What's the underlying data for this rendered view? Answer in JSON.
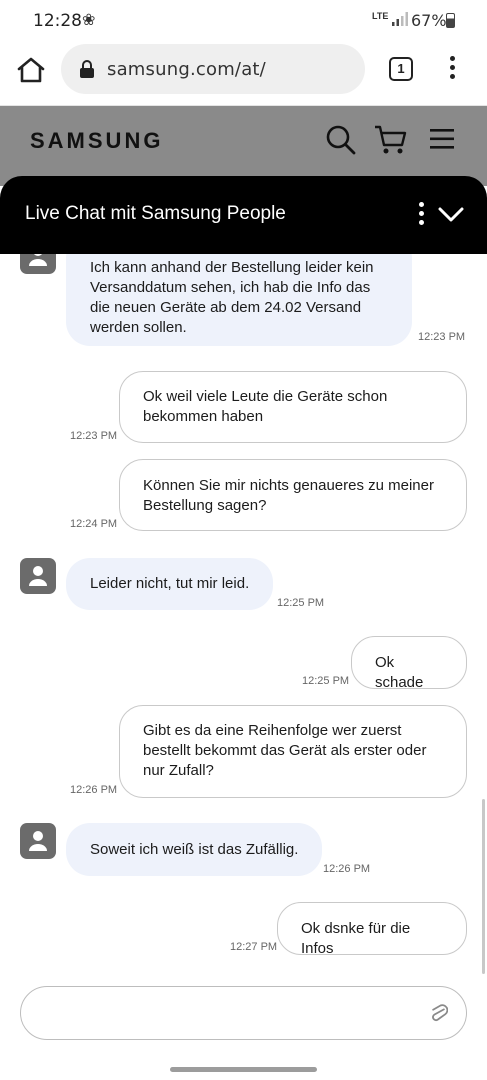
{
  "status": {
    "time": "12:28",
    "fan_glyph": "❀",
    "network": "LTE",
    "battery": "67%",
    "battery_level": 0.67
  },
  "browser": {
    "url": "samsung.com/at/",
    "tab_count": "1"
  },
  "site": {
    "brand": "SAMSUNG"
  },
  "chat": {
    "title": "Live Chat mit Samsung People",
    "messages": [
      {
        "from": "agent",
        "text": "Ich kann anhand der Bestellung leider kein Versanddatum sehen, ich hab die Info das die neuen Geräte ab dem 24.02 Versand werden sollen.",
        "time": "12:23 PM"
      },
      {
        "from": "user",
        "text": "Ok weil viele Leute die Geräte schon bekommen haben",
        "time": "12:23 PM"
      },
      {
        "from": "user",
        "text": "Können Sie mir nichts genaueres zu meiner Bestellung sagen?",
        "time": "12:24 PM"
      },
      {
        "from": "agent",
        "text": "Leider nicht, tut mir leid.",
        "time": "12:25 PM"
      },
      {
        "from": "user",
        "text": "Ok schade",
        "time": "12:25 PM"
      },
      {
        "from": "user",
        "text": "Gibt es da eine Reihenfolge wer zuerst bestellt bekommt das Gerät als erster oder nur Zufall?",
        "time": "12:26 PM"
      },
      {
        "from": "agent",
        "text": "Soweit ich weiß ist das Zufällig.",
        "time": "12:26 PM"
      },
      {
        "from": "user",
        "text": "Ok dsnke für die Infos",
        "time": "12:27 PM"
      }
    ],
    "input_placeholder": ""
  }
}
